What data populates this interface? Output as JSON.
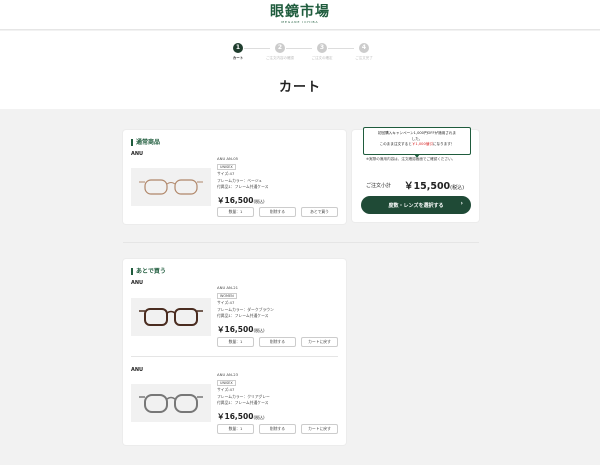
{
  "header": {
    "logo": "眼鏡市場",
    "logo_sub": "MEGANE ICHIBA"
  },
  "steps": [
    {
      "num": "1",
      "label": "カート",
      "active": true
    },
    {
      "num": "2",
      "label": "ご注文内容の確認",
      "active": false
    },
    {
      "num": "3",
      "label": "ご注文の確定",
      "active": false
    },
    {
      "num": "4",
      "label": "ご注文完了",
      "active": false
    }
  ],
  "page_title": "カート",
  "cart": {
    "section_title": "通常商品",
    "item": {
      "brand": "ANU",
      "model": "ANU AN-05",
      "tag": "UNISEX",
      "size": "サイズ:47",
      "color": "フレームカラー：ベージュ",
      "accessory": "付属品1：フレーム共通ケース",
      "price": "￥16,500",
      "tax": "(税込)",
      "qty": "数量：1",
      "delete": "削除する",
      "later": "あとで買う"
    }
  },
  "summary": {
    "bubble_line1": "初回購入キャンペーン1,000円OFFが適用されま",
    "bubble_line2": "した。",
    "bubble_line3a": "このまま注文すると",
    "bubble_line3b": "￥1,000値引",
    "bubble_line3c": "になります！",
    "note": "※実際の適用内容は、注文確認画面でご確認ください。",
    "subtotal_label": "ご注文小計",
    "subtotal": "￥15,500",
    "subtotal_tax": "(税込)",
    "cta": "度数・レンズを選択する",
    "cta_arrow": "›"
  },
  "later": {
    "section_title": "あとで買う",
    "items": [
      {
        "brand": "ANU",
        "model": "ANU AN-21",
        "tag": "WOMEN",
        "size": "サイズ:47",
        "color": "フレームカラー：ダークブラウン",
        "accessory": "付属品1：フレーム共通ケース",
        "price": "￥16,500",
        "tax": "(税込)",
        "qty": "数量：1",
        "delete": "削除する",
        "to_cart": "カートに戻す"
      },
      {
        "brand": "ANU",
        "model": "ANU AN-23",
        "tag": "UNISEX",
        "size": "サイズ:47",
        "color": "フレームカラー：クリアグレー",
        "accessory": "付属品1：フレーム共通ケース",
        "price": "￥16,500",
        "tax": "(税込)",
        "qty": "数量：1",
        "delete": "削除する",
        "to_cart": "カートに戻す"
      }
    ]
  }
}
